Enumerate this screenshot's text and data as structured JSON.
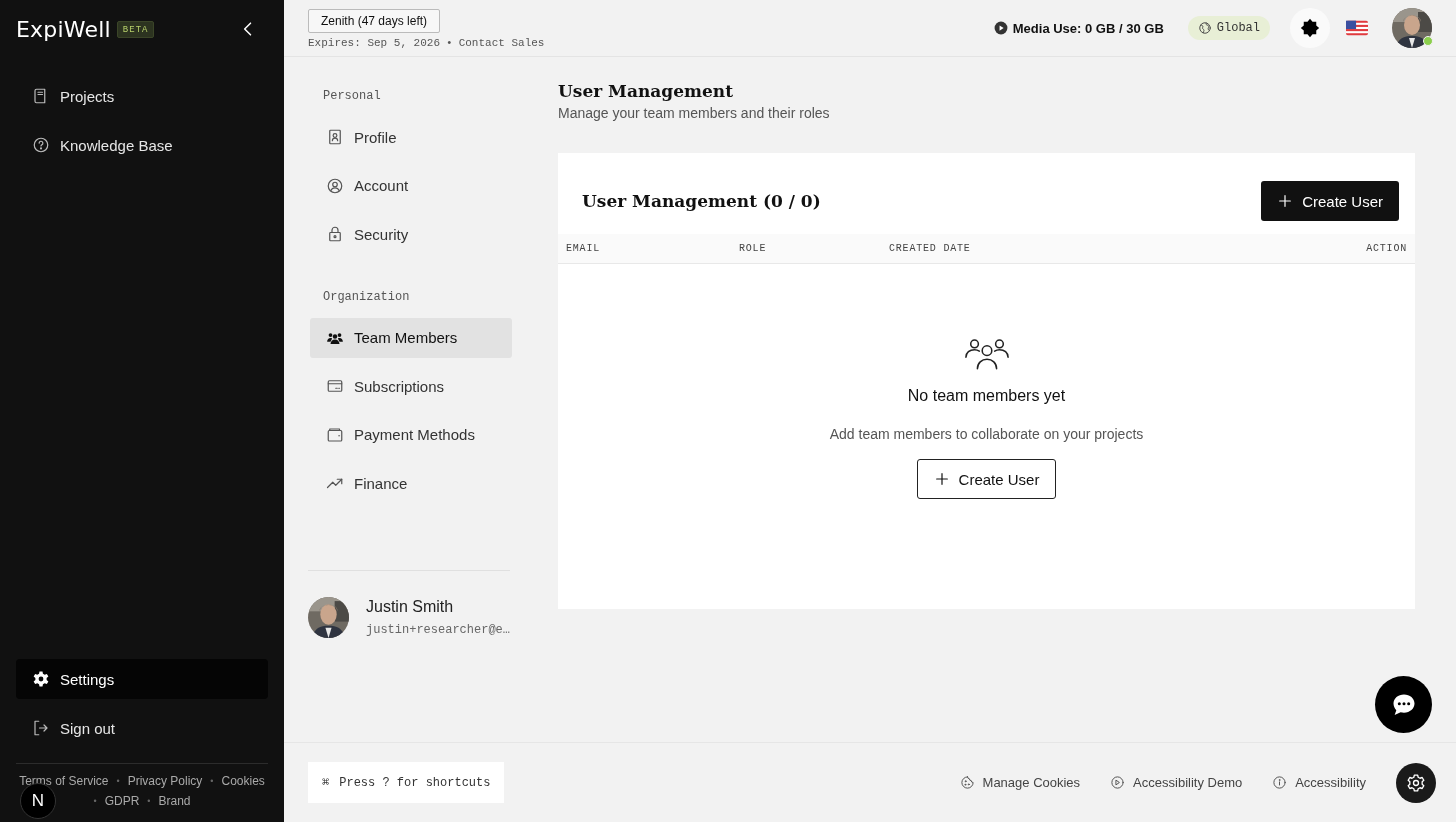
{
  "brand": {
    "name": "ExpiWell",
    "badge": "BETA"
  },
  "sidebar": {
    "items": [
      {
        "label": "Projects",
        "selected": false
      },
      {
        "label": "Knowledge Base",
        "selected": false
      }
    ],
    "bottom_items": [
      {
        "label": "Settings",
        "selected": true
      },
      {
        "label": "Sign out",
        "selected": false
      }
    ],
    "footer_links": [
      "Terms of Service",
      "Privacy Policy",
      "Cookies",
      "GDPR",
      "Brand"
    ],
    "separator": "•",
    "dev_badge": "N"
  },
  "topbar": {
    "plan_button": "Zenith (47 days left)",
    "expires": "Expires: Sep 5, 2026",
    "separator": "•",
    "contact": "Contact Sales",
    "media_use": "Media Use: 0 GB / 30 GB",
    "region": "Global",
    "online": true
  },
  "settings_nav": {
    "sections": [
      {
        "title": "Personal",
        "items": [
          {
            "label": "Profile",
            "selected": false
          },
          {
            "label": "Account",
            "selected": false
          },
          {
            "label": "Security",
            "selected": false
          }
        ]
      },
      {
        "title": "Organization",
        "items": [
          {
            "label": "Team Members",
            "selected": true
          },
          {
            "label": "Subscriptions",
            "selected": false
          },
          {
            "label": "Payment Methods",
            "selected": false
          },
          {
            "label": "Finance",
            "selected": false
          }
        ]
      }
    ],
    "user": {
      "name": "Justin Smith",
      "email": "justin+researcher@e…"
    }
  },
  "page": {
    "title": "User Management",
    "subtitle": "Manage your team members and their roles",
    "card": {
      "title": "User Management (0 / 0)",
      "create_button": "Create User",
      "columns": [
        "EMAIL",
        "ROLE",
        "CREATED DATE",
        "ACTION"
      ],
      "empty": {
        "title": "No team members yet",
        "text": "Add team members to collaborate on your projects",
        "button": "Create User"
      }
    }
  },
  "footer": {
    "shortcut_key": "⌘",
    "shortcut_text": "Press ? for shortcuts",
    "links": [
      {
        "label": "Manage Cookies"
      },
      {
        "label": "Accessibility Demo"
      },
      {
        "label": "Accessibility"
      }
    ]
  }
}
